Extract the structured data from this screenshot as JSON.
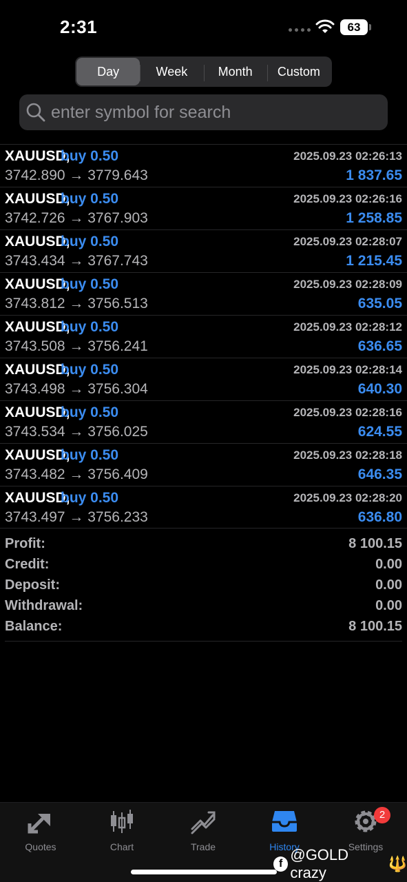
{
  "status_bar": {
    "time": "2:31",
    "battery": "63"
  },
  "period_tabs": [
    {
      "label": "Day",
      "active": true
    },
    {
      "label": "Week",
      "active": false
    },
    {
      "label": "Month",
      "active": false
    },
    {
      "label": "Custom",
      "active": false
    }
  ],
  "search": {
    "placeholder": "enter symbol for search",
    "value": ""
  },
  "deals": [
    {
      "symbol": "XAUUSD,",
      "type": "buy 0.50",
      "prices": "3742.890 → 3779.643",
      "time": "2025.09.23 02:26:13",
      "profit": "1 837.65"
    },
    {
      "symbol": "XAUUSD,",
      "type": "buy 0.50",
      "prices": "3742.726 → 3767.903",
      "time": "2025.09.23 02:26:16",
      "profit": "1 258.85"
    },
    {
      "symbol": "XAUUSD,",
      "type": "buy 0.50",
      "prices": "3743.434 → 3767.743",
      "time": "2025.09.23 02:28:07",
      "profit": "1 215.45"
    },
    {
      "symbol": "XAUUSD,",
      "type": "buy 0.50",
      "prices": "3743.812 → 3756.513",
      "time": "2025.09.23 02:28:09",
      "profit": "635.05"
    },
    {
      "symbol": "XAUUSD,",
      "type": "buy 0.50",
      "prices": "3743.508 → 3756.241",
      "time": "2025.09.23 02:28:12",
      "profit": "636.65"
    },
    {
      "symbol": "XAUUSD,",
      "type": "buy 0.50",
      "prices": "3743.498 → 3756.304",
      "time": "2025.09.23 02:28:14",
      "profit": "640.30"
    },
    {
      "symbol": "XAUUSD,",
      "type": "buy 0.50",
      "prices": "3743.534 → 3756.025",
      "time": "2025.09.23 02:28:16",
      "profit": "624.55"
    },
    {
      "symbol": "XAUUSD,",
      "type": "buy 0.50",
      "prices": "3743.482 → 3756.409",
      "time": "2025.09.23 02:28:18",
      "profit": "646.35"
    },
    {
      "symbol": "XAUUSD,",
      "type": "buy 0.50",
      "prices": "3743.497 → 3756.233",
      "time": "2025.09.23 02:28:20",
      "profit": "636.80"
    }
  ],
  "summary": [
    {
      "label": "Profit:",
      "value": "8 100.15"
    },
    {
      "label": "Credit:",
      "value": "0.00"
    },
    {
      "label": "Deposit:",
      "value": "0.00"
    },
    {
      "label": "Withdrawal:",
      "value": "0.00"
    },
    {
      "label": "Balance:",
      "value": "8 100.15"
    }
  ],
  "tabbar": [
    {
      "label": "Quotes",
      "icon": "quotes-icon",
      "active": false
    },
    {
      "label": "Chart",
      "icon": "chart-icon",
      "active": false
    },
    {
      "label": "Trade",
      "icon": "trade-icon",
      "active": false
    },
    {
      "label": "History",
      "icon": "history-icon",
      "active": true
    },
    {
      "label": "Settings",
      "icon": "settings-icon",
      "active": false,
      "badge": "2"
    }
  ],
  "watermark": {
    "text": "@GOLD crazy",
    "trailing_glyph": "🔱"
  },
  "colors": {
    "accent": "#3b8cf0",
    "background": "#000000",
    "badge": "#f23b3b",
    "muted_text": "#b5b5b8"
  }
}
